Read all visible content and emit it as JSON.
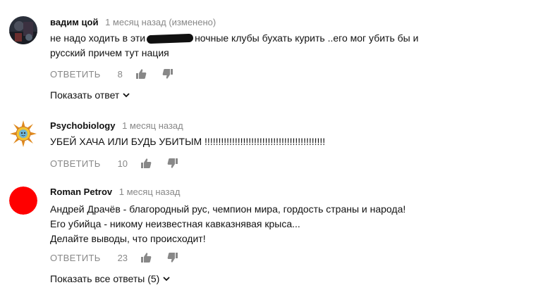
{
  "comments": [
    {
      "author": "вадим цой",
      "time": "1 месяц назад (изменено)",
      "text_before_redaction": "не надо ходить в эти",
      "text_after_redaction": "ночные клубы бухать курить ..его мог убить бы и",
      "text_line2": "русский  причем тут нация",
      "reply_label": "ОТВЕТИТЬ",
      "likes": "8",
      "show_replies": "Показать ответ"
    },
    {
      "author": "Psychobiology",
      "time": "1 месяц назад",
      "text_line1": "УБЕЙ  ХАЧА  ИЛИ   БУДЬ  УБИТЫМ !!!!!!!!!!!!!!!!!!!!!!!!!!!!!!!!!!!!!!!!!!!!",
      "reply_label": "ОТВЕТИТЬ",
      "likes": "10"
    },
    {
      "author": "Roman Petrov",
      "time": "1 месяц назад",
      "text_line1": "Андрей Драчёв - благородный рус, чемпион мира, гордость страны и народа!",
      "text_line2": "Его убийца - никому неизвестная кавказнявая крыса...",
      "text_line3": "Делайте выводы, что происходит!",
      "reply_label": "ОТВЕТИТЬ",
      "likes": "23",
      "show_replies": "Показать все ответы (5)",
      "avatar_color": "#ff0000"
    }
  ]
}
